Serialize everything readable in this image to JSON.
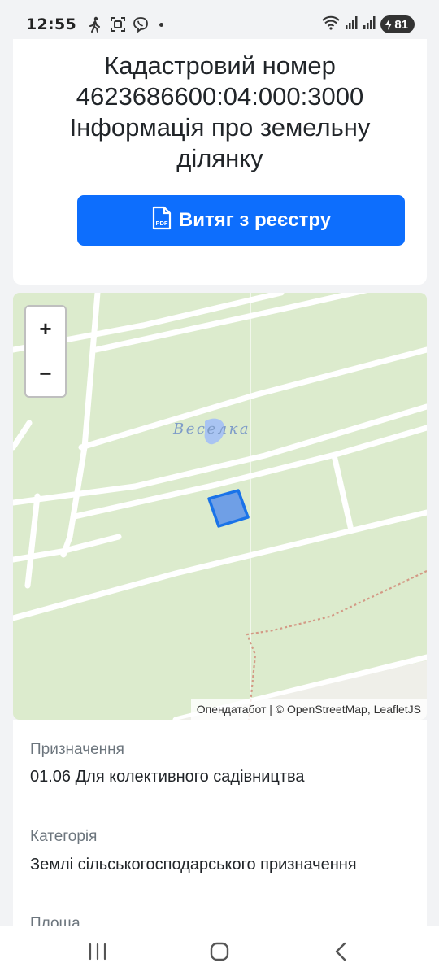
{
  "status_bar": {
    "time": "12:55",
    "battery": "81",
    "left_icons": [
      "walking-icon",
      "face-scan-icon",
      "viber-icon"
    ],
    "right_icons": [
      "wifi-icon",
      "signal-icon",
      "signal-icon",
      "battery-icon"
    ]
  },
  "header": {
    "title_lines": [
      "Кадастровий номер",
      "4623686600:04:000:3000",
      "Інформація про земельну",
      "ділянку"
    ],
    "pdf_button_label": "Витяг з реєстру"
  },
  "map": {
    "zoom_in": "+",
    "zoom_out": "−",
    "place_label": "Веселка",
    "attribution": "Опендатабот | © OpenStreetMap, LeafletJS",
    "colors": {
      "land": "#dcebcd",
      "road": "#ffffff",
      "parcel_fill": "#6f9fe6",
      "parcel_stroke": "#1a73e8"
    }
  },
  "info": {
    "purpose_label": "Призначення",
    "purpose_value": "01.06 Для колективного садівництва",
    "category_label": "Категорія",
    "category_value": "Землі сільськогосподарського призначення",
    "area_label": "Площа"
  },
  "colors": {
    "primary": "#0d6efd",
    "page_bg": "#f2f3f5",
    "card_bg": "#ffffff"
  }
}
